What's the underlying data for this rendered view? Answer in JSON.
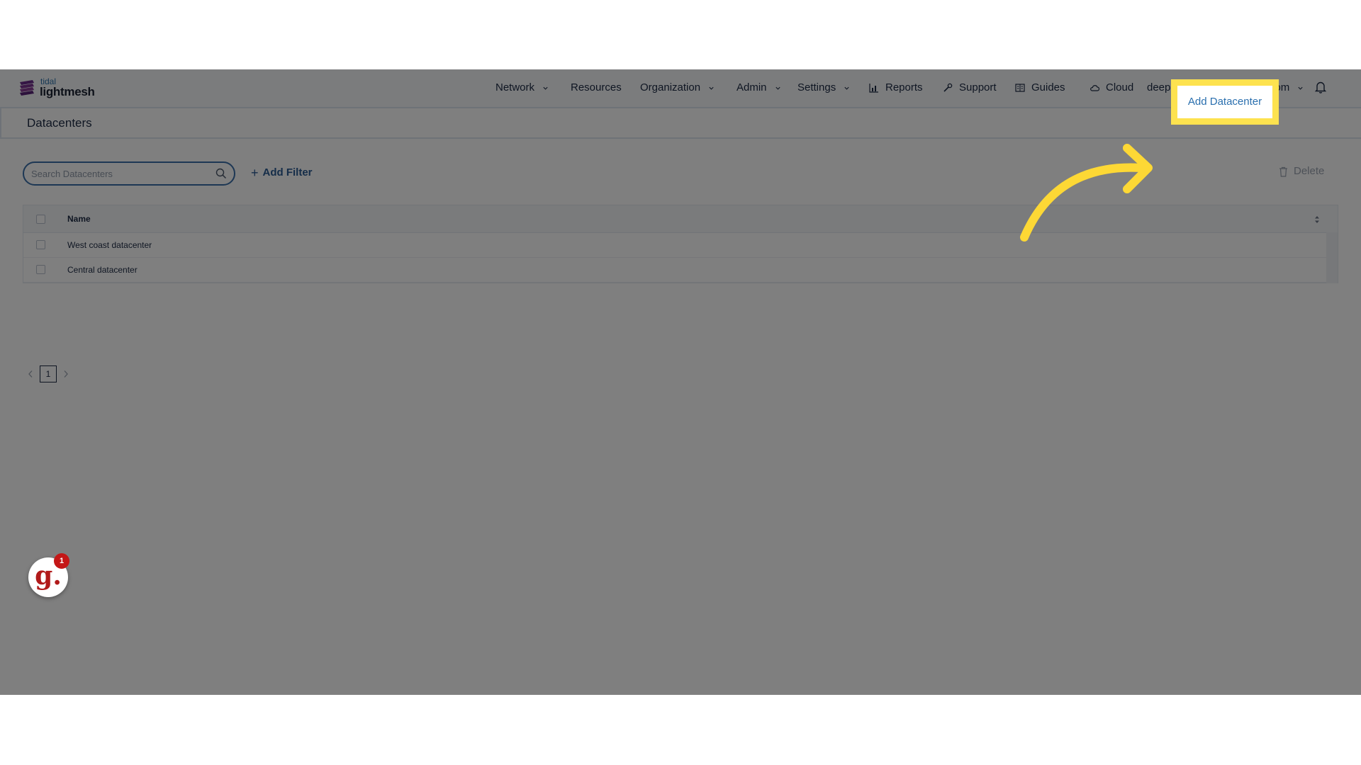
{
  "brand": {
    "top": "tidal",
    "main": "lightmesh"
  },
  "nav": {
    "network": "Network",
    "resources": "Resources",
    "organization": "Organization",
    "admin": "Admin",
    "settings": "Settings",
    "reports": "Reports",
    "support": "Support",
    "guides": "Guides",
    "cloud": "Cloud",
    "user": "deep.bhalotia@tidalcloud.com"
  },
  "page": {
    "title": "Datacenters"
  },
  "toolbar": {
    "search_placeholder": "Search Datacenters",
    "add_filter": "Add Filter",
    "add_datacenter": "Add Datacenter",
    "delete": "Delete"
  },
  "table": {
    "header_name": "Name",
    "rows": [
      "West coast datacenter",
      "Central datacenter"
    ]
  },
  "pagination": {
    "current_page": "1"
  },
  "guide_widget": {
    "letter": "g.",
    "badge_count": "1"
  },
  "colors": {
    "highlight": "#fde24f",
    "accent": "#2a6fae",
    "arrow": "#fdd835"
  },
  "icons": [
    "search-icon",
    "bell-icon",
    "reports-icon",
    "support-icon",
    "guides-icon",
    "cloud-icon",
    "trash-icon",
    "sort-icon",
    "chevron-down-icon",
    "chevron-left-icon",
    "chevron-right-icon",
    "arrow-annotation"
  ]
}
